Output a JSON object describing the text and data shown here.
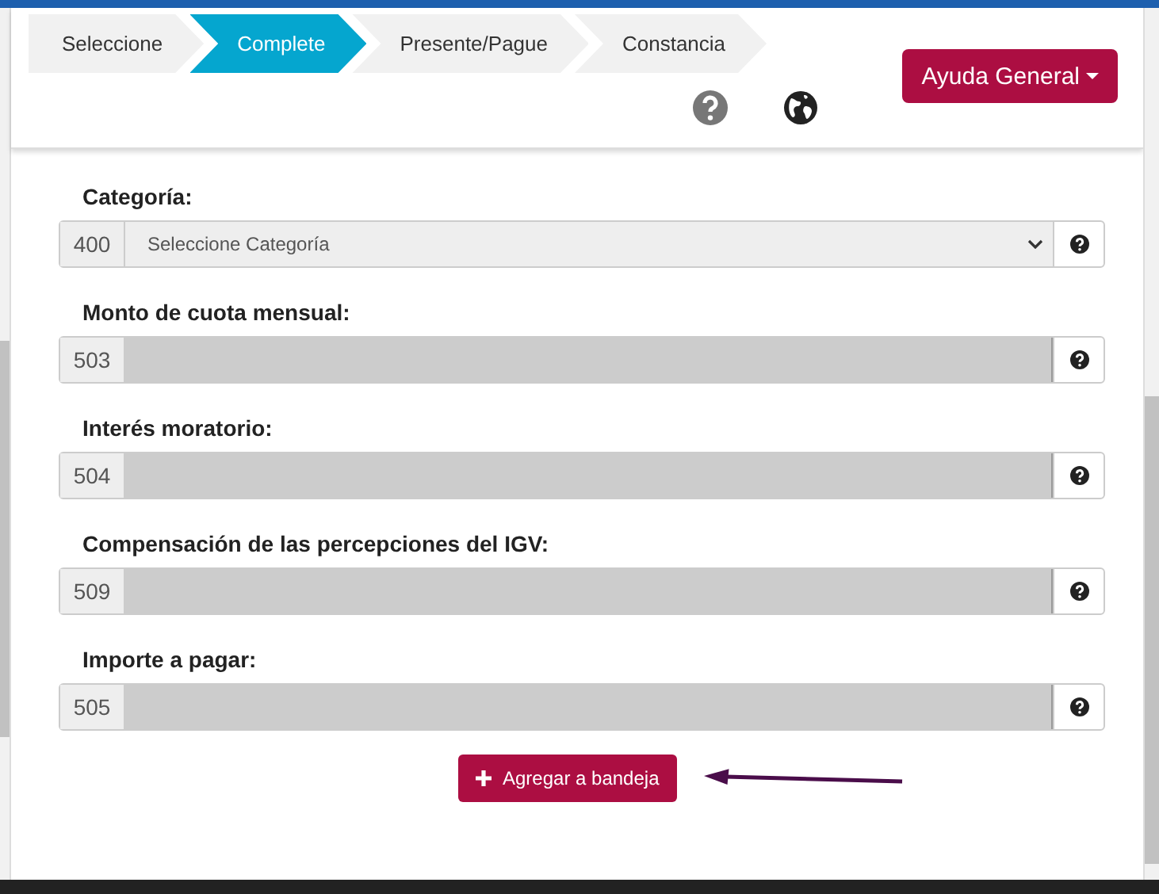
{
  "steps": [
    {
      "label": "Seleccione",
      "selected": false
    },
    {
      "label": "Complete",
      "selected": true
    },
    {
      "label": "Presente/Pague",
      "selected": false
    },
    {
      "label": "Constancia",
      "selected": false
    }
  ],
  "help_menu": {
    "label": "Ayuda General"
  },
  "fields": [
    {
      "kind": "select",
      "label": "Categoría:",
      "code": "400",
      "value": "Seleccione Categoría"
    },
    {
      "kind": "readonly",
      "label": "Monto de cuota mensual:",
      "code": "503"
    },
    {
      "kind": "readonly",
      "label": "Interés moratorio:",
      "code": "504"
    },
    {
      "kind": "readonly",
      "label": "Compensación de las percepciones del IGV:",
      "code": "509"
    },
    {
      "kind": "readonly",
      "label": "Importe a pagar:",
      "code": "505"
    }
  ],
  "add_button": {
    "label": "Agregar a bandeja"
  }
}
